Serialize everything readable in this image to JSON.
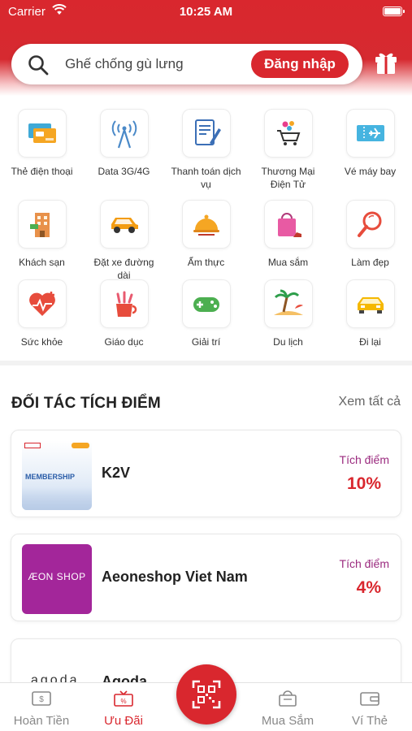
{
  "status_bar": {
    "carrier": "Carrier",
    "time": "10:25 AM"
  },
  "header": {
    "search_placeholder": "Ghế chống gù lưng",
    "login_label": "Đăng nhập"
  },
  "categories": [
    {
      "label": "Thẻ điện thoại",
      "icon": "phone-card-icon"
    },
    {
      "label": "Data 3G/4G",
      "icon": "antenna-icon"
    },
    {
      "label": "Thanh toán dịch vụ",
      "icon": "bill-payment-icon"
    },
    {
      "label": "Thương Mại Điện Tử",
      "icon": "ecommerce-cart-icon"
    },
    {
      "label": "Vé máy bay",
      "icon": "plane-ticket-icon"
    },
    {
      "label": "Khách sạn",
      "icon": "hotel-icon"
    },
    {
      "label": "Đặt xe đường dài",
      "icon": "car-icon"
    },
    {
      "label": "Ẩm thực",
      "icon": "food-cloche-icon"
    },
    {
      "label": "Mua sắm",
      "icon": "shopping-bag-icon"
    },
    {
      "label": "Làm đẹp",
      "icon": "beauty-mirror-icon"
    },
    {
      "label": "Sức khỏe",
      "icon": "health-heart-icon"
    },
    {
      "label": "Giáo dục",
      "icon": "education-icon"
    },
    {
      "label": "Giải trí",
      "icon": "gamepad-icon"
    },
    {
      "label": "Du lịch",
      "icon": "beach-icon"
    },
    {
      "label": "Đi lại",
      "icon": "taxi-icon"
    }
  ],
  "partners": {
    "title": "ĐỐI TÁC TÍCH ĐIỂM",
    "see_all": "Xem tất cả",
    "items": [
      {
        "name": "K2V",
        "points_label": "Tích điểm",
        "points": "10%",
        "logo_text": "MEMBERSHIP"
      },
      {
        "name": "Aeoneshop Viet Nam",
        "points_label": "Tích điểm",
        "points": "4%",
        "logo_text": "ÆON SHOP"
      },
      {
        "name": "Agoda",
        "logo_text": "agoda"
      }
    ]
  },
  "tabbar": {
    "items": [
      {
        "label": "Hoàn Tiền",
        "icon": "cashback-icon",
        "active": false
      },
      {
        "label": "Ưu Đãi",
        "icon": "voucher-icon",
        "active": true
      },
      {
        "label": "Mua Sắm",
        "icon": "shopping-basket-icon",
        "active": false
      },
      {
        "label": "Ví Thẻ",
        "icon": "wallet-icon",
        "active": false
      }
    ]
  },
  "colors": {
    "brand_red": "#d9272e",
    "points_label": "#9b2b7f",
    "aeon_magenta": "#a3269a"
  }
}
